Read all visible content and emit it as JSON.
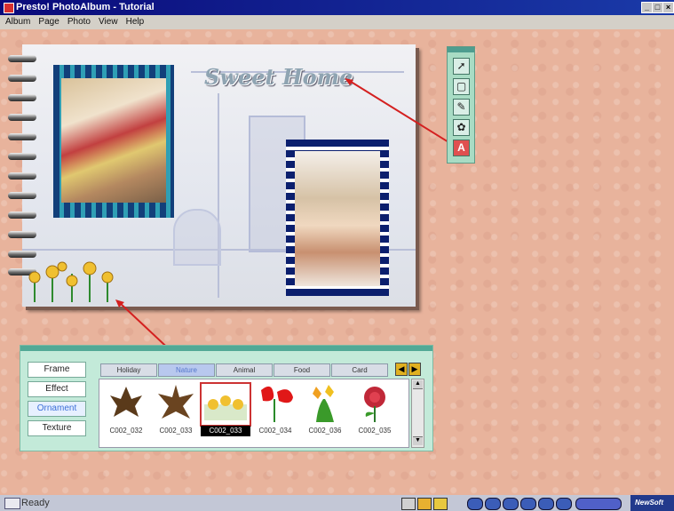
{
  "window": {
    "title": "Presto! PhotoAlbum - Tutorial",
    "controls": [
      "_",
      "□",
      "×"
    ]
  },
  "menu": [
    "Album",
    "Page",
    "Photo",
    "View",
    "Help"
  ],
  "album": {
    "title_art": "Sweet Home"
  },
  "toolbox": {
    "icons": [
      "pointer-icon",
      "crop-icon",
      "brush-icon",
      "stamp-icon",
      "text-icon"
    ],
    "text_tool_glyph": "A"
  },
  "palette": {
    "side_buttons": [
      "Frame",
      "Effect",
      "Ornament",
      "Texture"
    ],
    "active_side": "Ornament",
    "tabs": [
      "Holiday",
      "Nature",
      "Animal",
      "Food",
      "Card"
    ],
    "active_tab": "Nature",
    "items": [
      "C002_032",
      "C002_033",
      "C002_033",
      "C002_034",
      "C002_036",
      "C002_035"
    ],
    "selected_index": 2
  },
  "status": {
    "text": "Ready",
    "brand": "NewSoft"
  }
}
